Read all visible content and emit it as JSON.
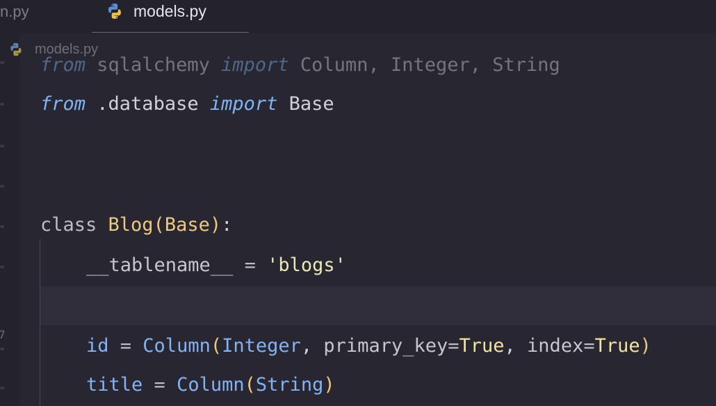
{
  "tabs": {
    "previous_label": "n.py",
    "active_label": "models.py"
  },
  "breadcrumb": {
    "file_label": "models.py"
  },
  "gutter": {
    "visible_number": "7"
  },
  "code": {
    "line1": {
      "from": "from",
      "module": " sqlalchemy ",
      "import": "import",
      "names": " Column, Integer, String"
    },
    "line2": {
      "from": "from",
      "module": " .database ",
      "import": "import",
      "names": " Base"
    },
    "line5": {
      "class": "class",
      "name": " Blog",
      "paren_open": "(",
      "base": "Base",
      "paren_close": ")",
      "colon": ":"
    },
    "line6": {
      "attr": "__tablename__",
      "eq": " = ",
      "value": "'blogs'"
    },
    "line8": {
      "var": "id",
      "eq": " = ",
      "fn": "Column",
      "open": "(",
      "arg1": "Integer",
      "sep1": ", ",
      "kw1": "primary_key",
      "eq1": "=",
      "val1": "True",
      "sep2": ", ",
      "kw2": "index",
      "eq2": "=",
      "val2": "True",
      "close": ")"
    },
    "line9": {
      "var": "title",
      "eq": " = ",
      "fn": "Column",
      "open": "(",
      "arg1": "String",
      "close": ")"
    }
  },
  "colors": {
    "background": "#282731",
    "keyword_italic": "#7fb5f5",
    "class_name": "#f0c981",
    "string": "#ece7b7",
    "function": "#83b2f5"
  },
  "icons": {
    "tab_icon": "python-icon",
    "breadcrumb_icon": "python-icon"
  }
}
